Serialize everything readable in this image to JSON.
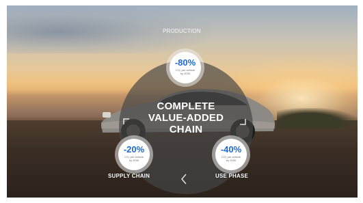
{
  "center": {
    "title": "COMPLETE\nVALUE-ADDED\nCHAIN"
  },
  "stages": {
    "production": {
      "label": "PRODUCTION",
      "percent": "-80%",
      "note": "CO₂ per vehicle\nby 2030"
    },
    "supply_chain": {
      "label": "SUPPLY CHAIN",
      "percent": "-20%",
      "note": "CO₂ per vehicle\nby 2030"
    },
    "use_phase": {
      "label": "USE PHASE",
      "percent": "-40%",
      "note": "CO₂ per vehicle\nby 2030"
    }
  },
  "colors": {
    "accent": "#1c69d4",
    "disc": "#464646"
  },
  "icons": {
    "left_arrow": "chevron-up-left-icon",
    "right_arrow": "chevron-down-right-icon",
    "bottom_arrow": "chevron-left-icon"
  }
}
